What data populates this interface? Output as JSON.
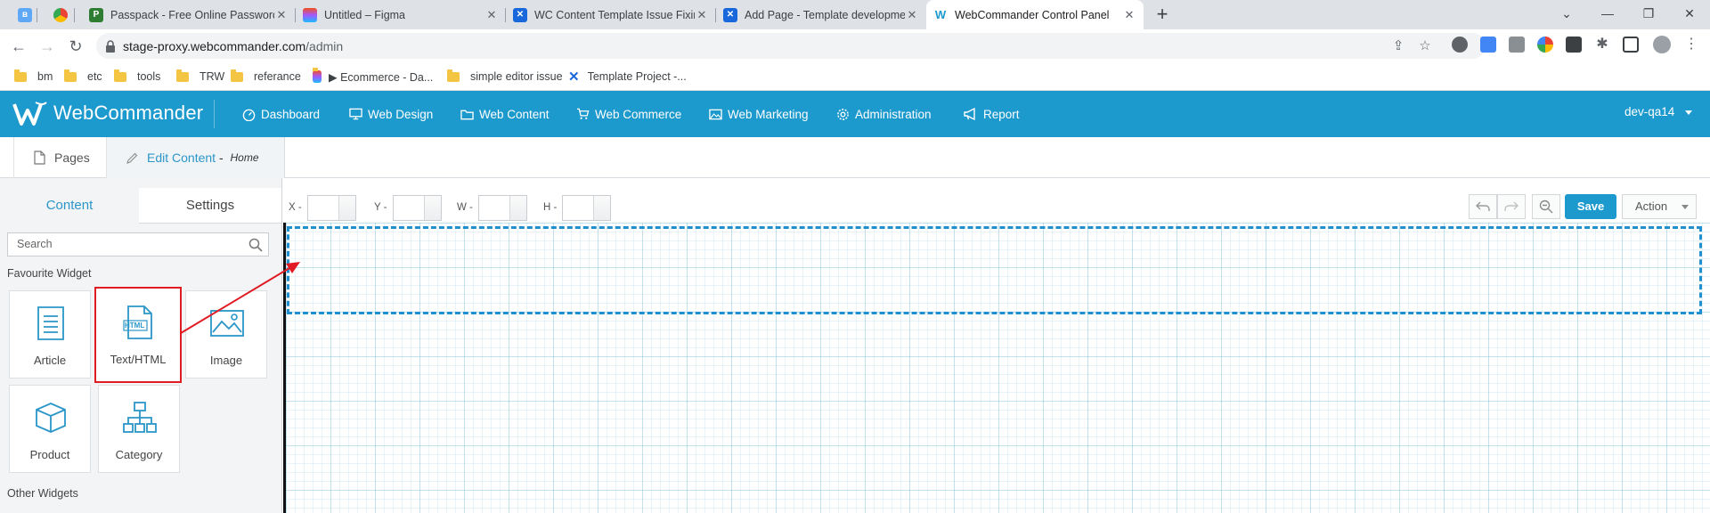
{
  "browser": {
    "tabs": [
      {
        "title": "",
        "favicon": "bluetooth-app-icon"
      },
      {
        "title": "",
        "favicon": "chrome-colorful-icon"
      },
      {
        "title": "Passpack - Free Online Password",
        "favicon": "passpack-icon"
      },
      {
        "title": "Untitled – Figma",
        "favicon": "figma-icon"
      },
      {
        "title": "WC Content Template Issue Fixin",
        "favicon": "confluence-icon"
      },
      {
        "title": "Add Page - Template developme",
        "favicon": "confluence-icon"
      },
      {
        "title": "WebCommander Control Panel",
        "favicon": "webcommander-icon"
      }
    ],
    "new_tab_symbol": "+",
    "url_host": "stage-proxy.webcommander.com",
    "url_path": "/admin",
    "bookmarks": [
      {
        "label": "bm",
        "type": "folder"
      },
      {
        "label": "etc",
        "type": "folder"
      },
      {
        "label": "tools",
        "type": "folder"
      },
      {
        "label": "TRW",
        "type": "folder"
      },
      {
        "label": "referance",
        "type": "folder"
      },
      {
        "label": "▶ Ecommerce - Da...",
        "type": "figma"
      },
      {
        "label": "simple editor issue",
        "type": "folder"
      },
      {
        "label": "Template Project -...",
        "type": "confluence"
      }
    ]
  },
  "app": {
    "brand": "WebCommander",
    "menu": [
      {
        "label": "Dashboard",
        "icon": "dashboard-icon"
      },
      {
        "label": "Web Design",
        "icon": "monitor-icon"
      },
      {
        "label": "Web Content",
        "icon": "folder-icon"
      },
      {
        "label": "Web Commerce",
        "icon": "cart-icon"
      },
      {
        "label": "Web Marketing",
        "icon": "image-icon"
      },
      {
        "label": "Administration",
        "icon": "gear-icon"
      },
      {
        "label": "Report",
        "icon": "megaphone-icon"
      }
    ],
    "user": "dev-qa14",
    "accent": "#1c99cd"
  },
  "subtabs": {
    "pages": "Pages",
    "edit": "Edit Content",
    "edit_sep": " - ",
    "edit_page": "Home"
  },
  "left_panel": {
    "tabs": {
      "content": "Content",
      "settings": "Settings"
    },
    "search_placeholder": "Search",
    "favourite_label": "Favourite Widget",
    "favourite_widgets": [
      {
        "label": "Article",
        "icon": "article-icon"
      },
      {
        "label": "Text/HTML",
        "icon": "html-file-icon",
        "highlighted": true
      },
      {
        "label": "Image",
        "icon": "image-icon"
      },
      {
        "label": "Product",
        "icon": "product-box-icon"
      },
      {
        "label": "Category",
        "icon": "category-tree-icon"
      }
    ],
    "other_label": "Other Widgets"
  },
  "editor": {
    "coords": {
      "x": "X -",
      "y": "Y -",
      "w": "W -",
      "h": "H -"
    },
    "save": "Save",
    "action": "Action"
  },
  "annotation": {
    "color": "#e01b24",
    "from": "Text/HTML widget",
    "to": "canvas drop zone"
  }
}
